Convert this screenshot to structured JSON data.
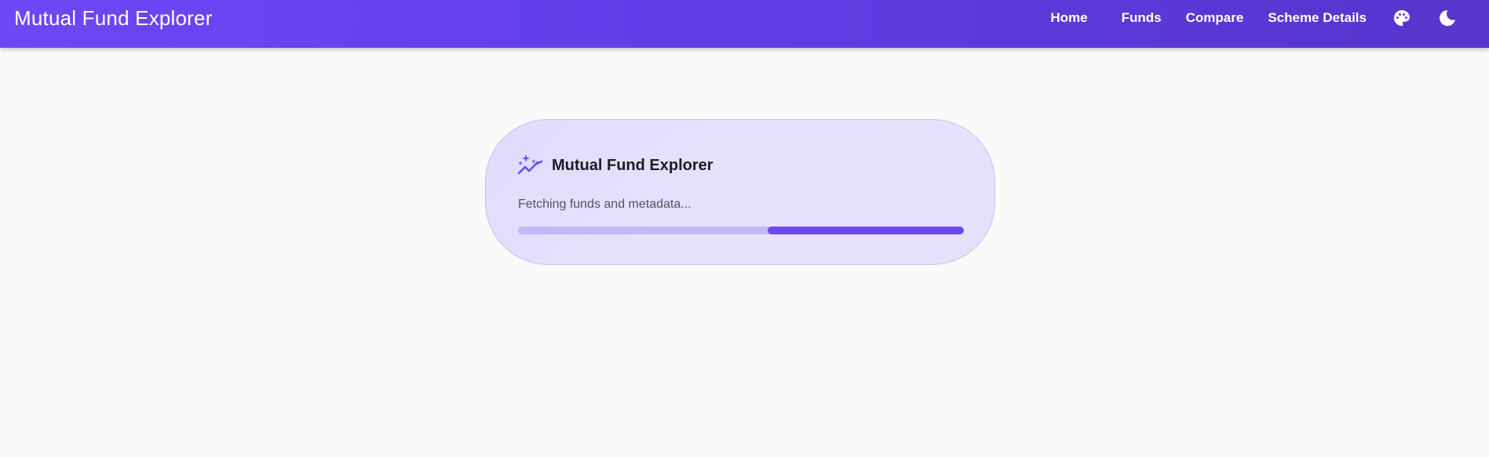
{
  "header": {
    "brand": "Mutual Fund Explorer",
    "nav": {
      "home": "Home",
      "funds": "Funds",
      "compare": "Compare",
      "scheme_details": "Scheme Details"
    },
    "icons": {
      "theme_palette": "palette-icon",
      "dark_mode": "moon-icon"
    }
  },
  "loader": {
    "icon": "sparkle-chart-icon",
    "title": "Mutual Fund Explorer",
    "status": "Fetching funds and metadata...",
    "progress": {
      "start_fraction": 0.56,
      "end_fraction": 1.0
    }
  },
  "colors": {
    "header_gradient_start": "#6f47f5",
    "header_gradient_end": "#5535cc",
    "card_bg": "#e5dffd",
    "progress_track": "#c3b9f6",
    "progress_fill": "#6a4af0",
    "page_bg": "#fafafa"
  }
}
